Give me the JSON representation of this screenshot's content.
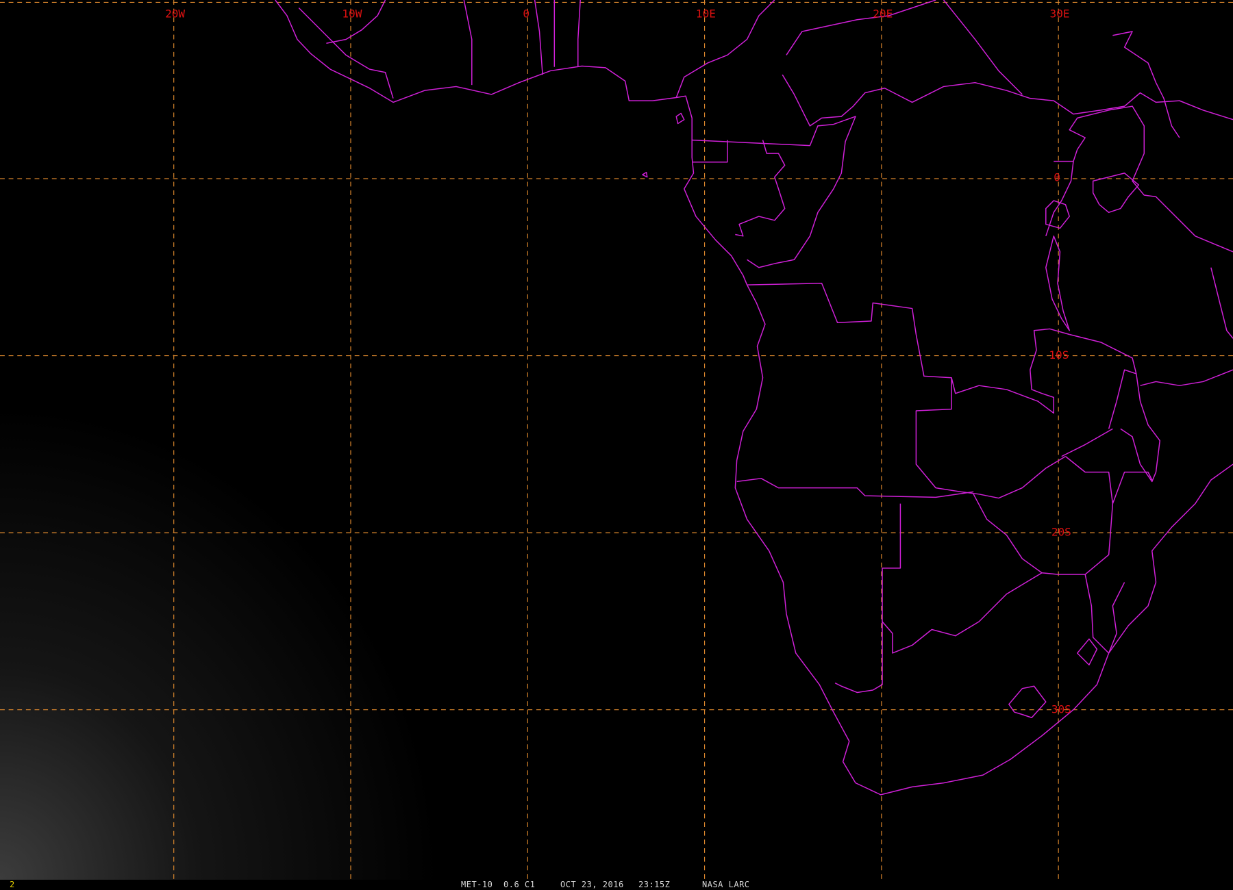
{
  "image": {
    "satellite": "MET-10",
    "channel": "0.6 C1",
    "date": "OCT 23, 2016",
    "time": "23:15Z",
    "source": "NASA LARC",
    "frame": "2"
  },
  "colors": {
    "background": "#000000",
    "grid": "#e08a2e",
    "grid_label": "#dd1111",
    "coastline": "#d020d8",
    "status_text": "#d8d8d8",
    "frame_number": "#e6d200"
  },
  "map": {
    "projection": "geostationary",
    "lon_range": [
      -30,
      40
    ],
    "lat_range": [
      -40,
      10
    ],
    "grid_step_deg": 10
  },
  "gridlabels": {
    "lon": [
      "20W",
      "10W",
      "0",
      "10E",
      "20E",
      "30E"
    ],
    "lat": [
      "0",
      "10S",
      "20S",
      "30S"
    ]
  }
}
